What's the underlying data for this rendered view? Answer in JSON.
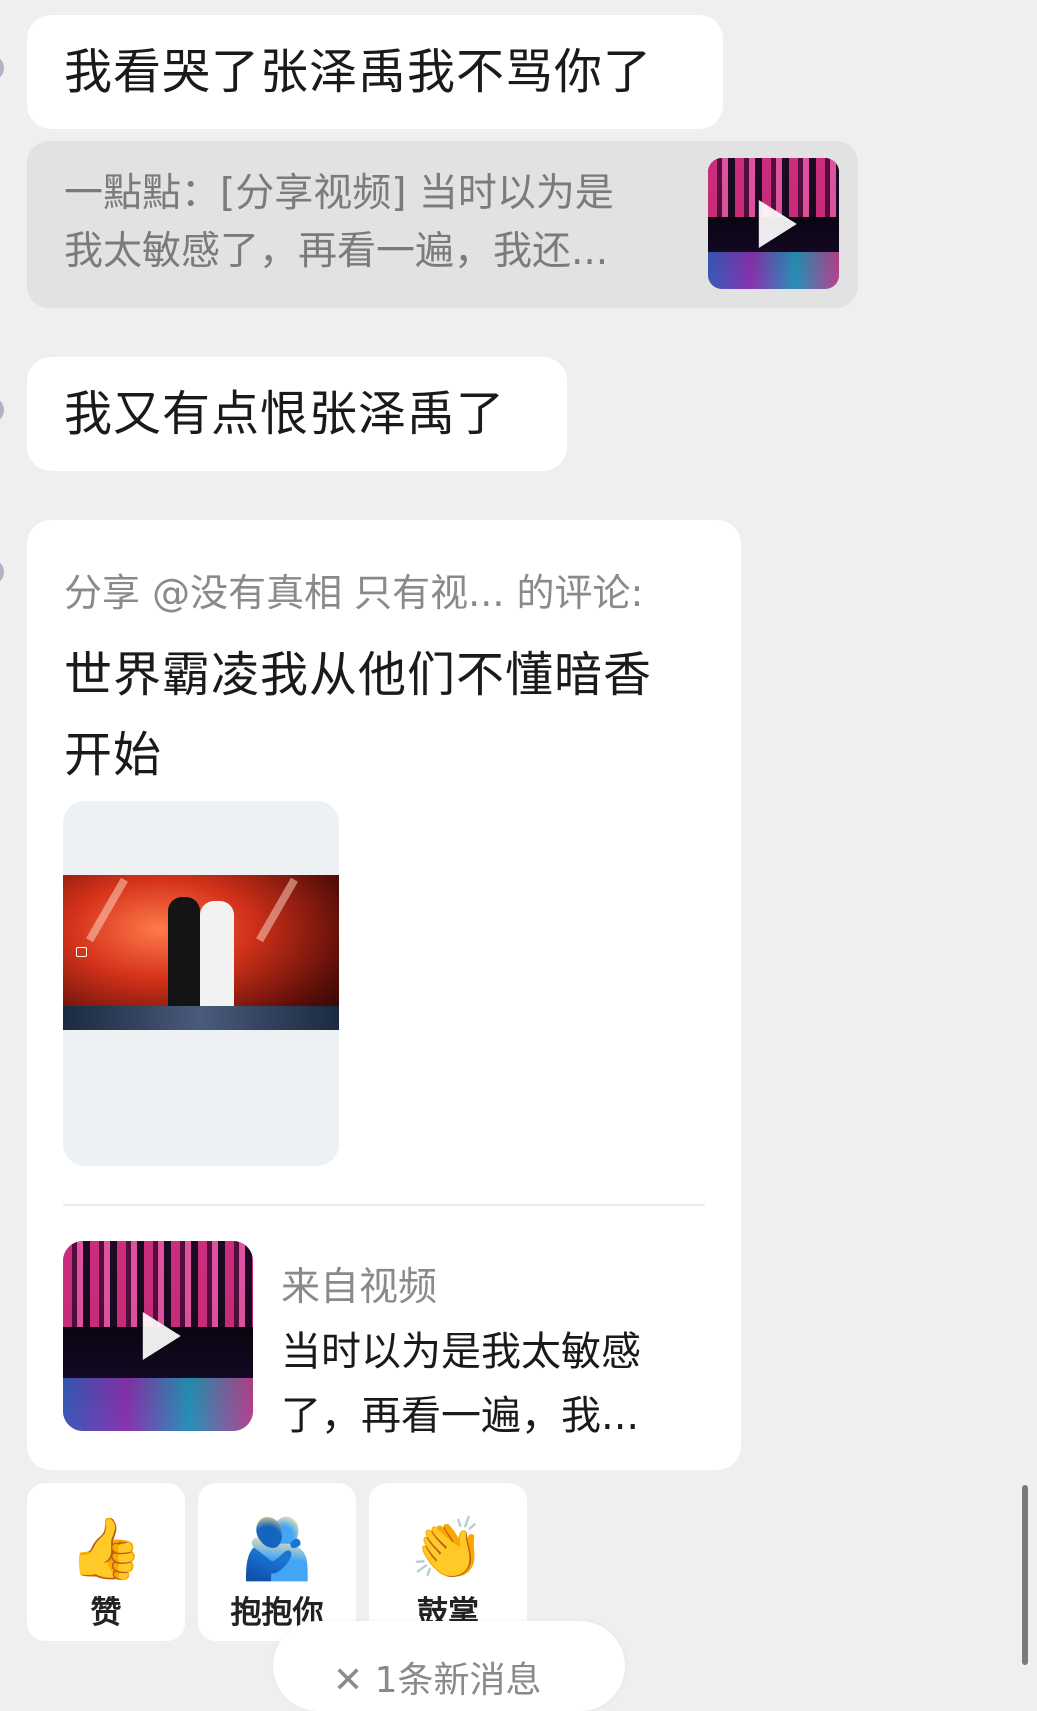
{
  "messages": [
    {
      "text": "我看哭了张泽禹我不骂你了"
    },
    {
      "text": "我又有点恨张泽禹了"
    }
  ],
  "quote": {
    "line1": "一點點：[分享视频] 当时以为是",
    "line2": "我太敏感了，再看一遍，我还..."
  },
  "share_card": {
    "header": "分享 @没有真相 只有视... 的评论:",
    "body": "世界霸凌我从他们不懂暗香开始",
    "source_label": "来自视频",
    "source_line1": "当时以为是我太敏感",
    "source_line2": "了，再看一遍，我..."
  },
  "reactions": [
    {
      "emoji": "👍",
      "icon": "thumbs-up-icon",
      "label": "赞"
    },
    {
      "emoji": "🫂",
      "icon": "hug-icon",
      "label": "抱抱你"
    },
    {
      "emoji": "👏",
      "icon": "clapping-hands-icon",
      "label": "鼓掌"
    }
  ],
  "new_messages": {
    "text": "✕ 1条新消息"
  }
}
